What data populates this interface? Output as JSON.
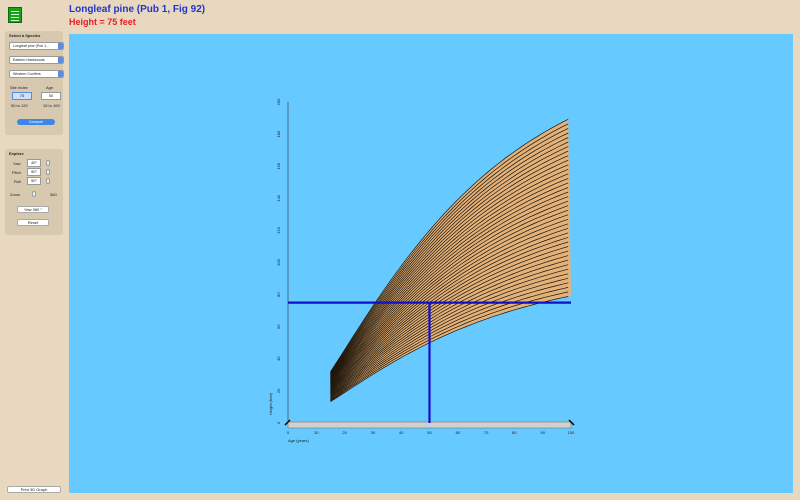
{
  "header": {
    "title": "Longleaf pine (Pub 1, Fig 92)",
    "subtitle": "Height = 75 feet"
  },
  "species_panel": {
    "label": "Select a Species",
    "species_select": "Longleaf pine (Pub 1...",
    "group_select": "Eastern Hardwoods",
    "region_select": "Western Conifers",
    "site_index_label": "Site Index",
    "age_label": "Age",
    "site_index_value": "75",
    "age_value": "50",
    "site_index_range": "50 to 120",
    "age_range": "15 to 100",
    "compute_label": "Compute"
  },
  "explore_panel": {
    "label": "Explore",
    "yaw_label": "Yaw",
    "yaw_value": "45°",
    "pitch_label": "Pitch",
    "pitch_value": "90°",
    "roll_label": "Roll",
    "roll_value": "90°",
    "zoom_label": "Zoom",
    "zoom_value": "360",
    "yaw360_label": "Yaw 360 °",
    "reset_label": "Reset"
  },
  "print_label": "Print 3D Graph",
  "chart_data": {
    "type": "line",
    "xlabel": "Age (years)",
    "ylabel": "Height (feet)",
    "xlim": [
      0,
      100
    ],
    "ylim": [
      0,
      200
    ],
    "x_ticks": [
      0,
      10,
      20,
      30,
      40,
      50,
      60,
      70,
      80,
      90,
      100
    ],
    "y_ticks": [
      0,
      20,
      40,
      60,
      80,
      100,
      120,
      140,
      160,
      180,
      200
    ],
    "site_index_range": [
      50,
      120
    ],
    "age_range": [
      15,
      100
    ],
    "curve_count": 40,
    "curve_fill_color": "#e3b27a",
    "curve_line_color": "#1a1208",
    "selected": {
      "site_index": 75,
      "age": 50,
      "height": 75
    },
    "marker_color": "#1010c8"
  }
}
